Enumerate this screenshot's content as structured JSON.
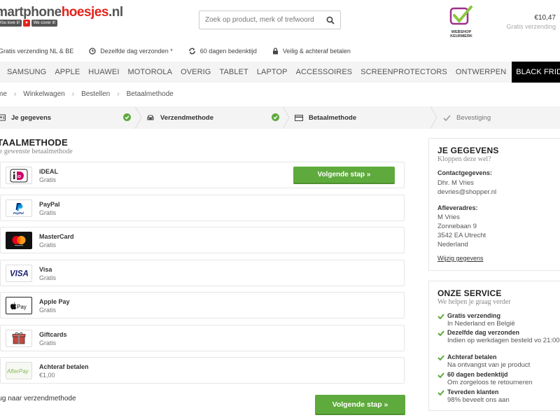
{
  "header": {
    "logo_text_1": "martphone",
    "logo_text_2": "hoesjes",
    "logo_text_3": ".nl",
    "logo_tag_1": "You love it!",
    "logo_tag_2": "We cover it!",
    "search_placeholder": "Zoek op product, merk of trefwoord",
    "keurmerk_line1": "WEBSHOP",
    "keurmerk_line2": "KEURMERK",
    "cart_price": "€10,47",
    "cart_shipping": "Gratis verzending"
  },
  "usps": [
    {
      "icon": "check-icon",
      "text": "Gratis verzending NL & BE"
    },
    {
      "icon": "clock-icon",
      "text": "Dezelfde dag verzonden *"
    },
    {
      "icon": "refresh-icon",
      "text": "60 dagen bedenktijd"
    },
    {
      "icon": "lock-icon",
      "text": "Veilig & achteraf betalen"
    }
  ],
  "nav": [
    "SAMSUNG",
    "APPLE",
    "HUAWEI",
    "MOTOROLA",
    "OVERIG",
    "TABLET",
    "LAPTOP",
    "ACCESSOIRES",
    "SCREENPROTECTORS",
    "ONTWERPEN",
    "BLACK FRIDAY"
  ],
  "breadcrumb": [
    "me",
    "Winkelwagen",
    "Bestellen",
    "Betaalmethode"
  ],
  "steps": [
    {
      "label": "Je gegevens",
      "state": "done"
    },
    {
      "label": "Verzendmethode",
      "state": "done"
    },
    {
      "label": "Betaalmethode",
      "state": "active"
    },
    {
      "label": "Bevestiging",
      "state": "inactive"
    }
  ],
  "section": {
    "title": "TAALMETHODE",
    "subtitle": "je gewenste betaalmethode"
  },
  "methods": [
    {
      "name": "iDEAL",
      "price": "Gratis",
      "logo": "ideal-logo"
    },
    {
      "name": "PayPal",
      "price": "Gratis",
      "logo": "paypal-logo"
    },
    {
      "name": "MasterCard",
      "price": "Gratis",
      "logo": "mastercard-logo"
    },
    {
      "name": "Visa",
      "price": "Gratis",
      "logo": "visa-logo"
    },
    {
      "name": "Apple Pay",
      "price": "Gratis",
      "logo": "applepay-logo"
    },
    {
      "name": "Giftcards",
      "price": "Gratis",
      "logo": "giftcard-logo"
    },
    {
      "name": "Achteraf betalen",
      "price": "€1,00",
      "logo": "afterpay-logo"
    }
  ],
  "buttons": {
    "next_inline": "Volgende stap »",
    "next": "Volgende stap »",
    "back": "rug naar verzendmethode"
  },
  "gegevens": {
    "title": "JE GEGEVENS",
    "subtitle": "Kloppen deze wel?",
    "contact_label": "Contactgegevens:",
    "contact_name": "Dhr. M Vries",
    "contact_email": "devries@shopper.nl",
    "address_label": "Afleveradres:",
    "address_lines": [
      "M Vries",
      "Zonnebaan 9",
      "3542 EA Utrecht",
      "Nederland"
    ],
    "edit_link": "Wijzig gegevens"
  },
  "service": {
    "title": "ONZE SERVICE",
    "subtitle": "We helpen je graag verder",
    "items": [
      {
        "title": "Gratis verzending",
        "desc": "In Nederland en België"
      },
      {
        "title": "Dezelfde dag verzonden",
        "desc": "Indien op werkdagen besteld vo 21:00"
      },
      {
        "title": "Achteraf betalen",
        "desc": "Na ontvangst van je product"
      },
      {
        "title": "60 dagen bedenktijd",
        "desc": "Om zorgeloos te retourneren"
      },
      {
        "title": "Tevreden klanten",
        "desc": "98% beveelt ons aan"
      }
    ]
  },
  "colors": {
    "accent_red": "#e2231a",
    "button_green": "#5eaa3c",
    "check_green": "#5eaa3c",
    "keurmerk_purple": "#a0308a",
    "keurmerk_green": "#8cc63f"
  }
}
